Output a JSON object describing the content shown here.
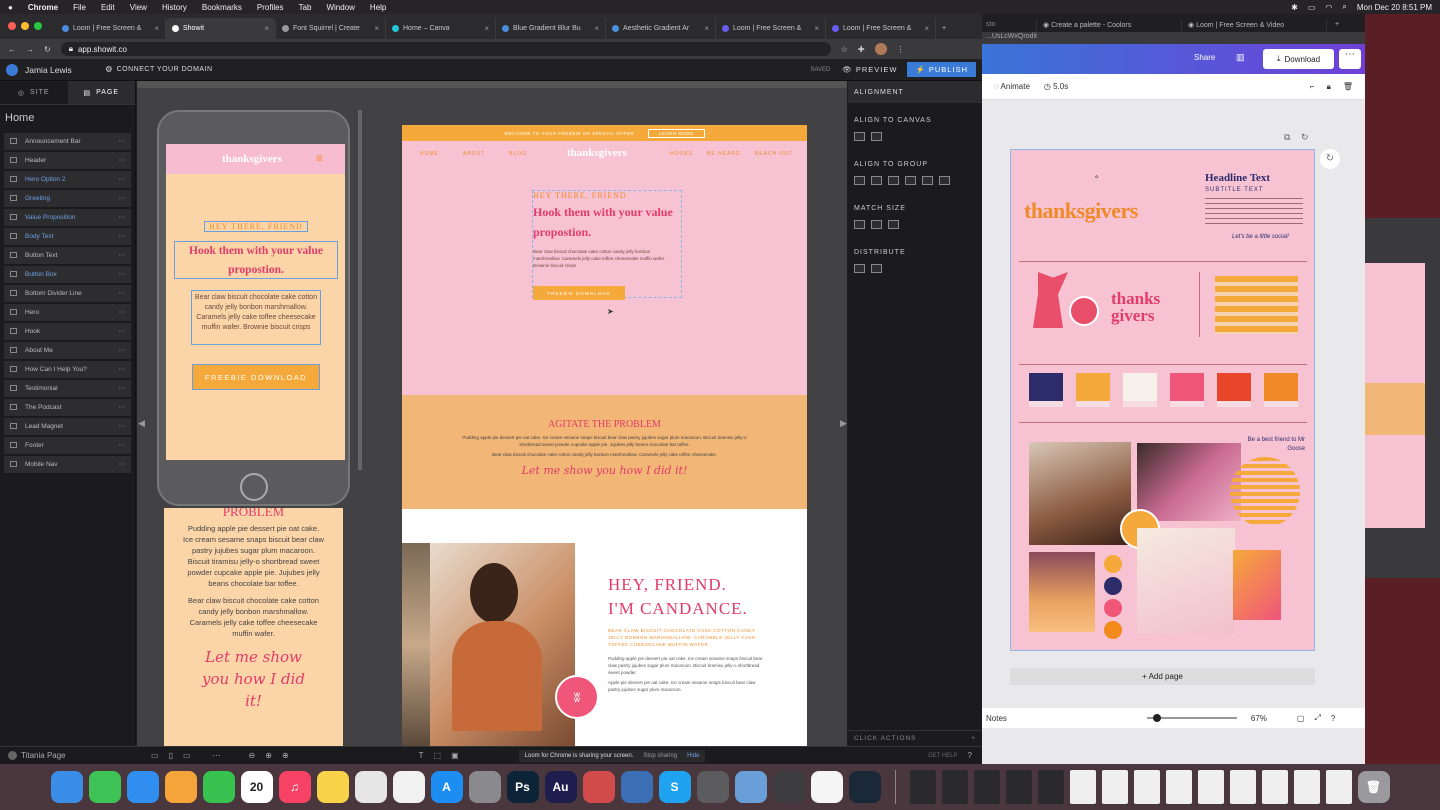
{
  "menubar": {
    "apple": "",
    "app": "Chrome",
    "items": [
      "File",
      "Edit",
      "View",
      "History",
      "Bookmarks",
      "Profiles",
      "Tab",
      "Window",
      "Help"
    ],
    "clock": "Mon Dec 20 8:51 PM"
  },
  "browser": {
    "tabs": [
      {
        "title": "Loom | Free Screen &"
      },
      {
        "title": "Showit",
        "active": true
      },
      {
        "title": "Font Squirrel | Create"
      },
      {
        "title": "Home – Canva"
      },
      {
        "title": "Blue Gradient Blur Bu"
      },
      {
        "title": "Aesthetic Gradient Ar"
      },
      {
        "title": "Loom | Free Screen &"
      },
      {
        "title": "Loom | Free Screen &"
      }
    ],
    "url": "app.showit.co"
  },
  "showit": {
    "user": "Jamia Lewis",
    "connect_domain": "CONNECT YOUR DOMAIN",
    "saved": "SAVED",
    "preview": "PREVIEW",
    "publish": "PUBLISH",
    "sidebar_tabs": [
      "SITE",
      "PAGE"
    ],
    "page_title": "Home",
    "layers": [
      {
        "label": "Announcement Bar",
        "sel": false
      },
      {
        "label": "Header",
        "sel": false
      },
      {
        "label": "Hero Option 2",
        "sel": true
      },
      {
        "label": "Greeting",
        "sel": true
      },
      {
        "label": "Value Proposition",
        "sel": true
      },
      {
        "label": "Body Text",
        "sel": true
      },
      {
        "label": "Button Text",
        "sel": false
      },
      {
        "label": "Button Box",
        "sel": true
      },
      {
        "label": "Bottom Divider Line",
        "sel": false
      },
      {
        "label": "Hero",
        "sel": false
      },
      {
        "label": "Hook",
        "sel": false
      },
      {
        "label": "About Me",
        "sel": false
      },
      {
        "label": "How Can I Help You?",
        "sel": false
      },
      {
        "label": "Testimonial",
        "sel": false
      },
      {
        "label": "The Podcast",
        "sel": false
      },
      {
        "label": "Lead Magnet",
        "sel": false
      },
      {
        "label": "Footer",
        "sel": false
      },
      {
        "label": "Mobile Nav",
        "sel": false
      }
    ],
    "right_panel": {
      "tab": "ALIGNMENT",
      "align_canvas": "ALIGN TO CANVAS",
      "align_group": "ALIGN TO GROUP",
      "match_size": "MATCH SIZE",
      "distribute": "DISTRIBUTE",
      "click_actions": "CLICK ACTIONS",
      "get_help": "GET HELP"
    },
    "status": {
      "page": "Titania Page",
      "loom_msg": "Loom for Chrome is sharing your screen.",
      "stop": "Stop sharing",
      "hide": "Hide"
    },
    "mobile": {
      "brand": "thanksgivers",
      "greeting": "HEY THERE, FRIEND",
      "hook": "Hook them with your value propostion.",
      "body": "Bear claw biscuit chocolate cake cotton candy jelly bonbon marshmallow. Caramels jelly cake toffee cheesecake muffin wafer. Brownie biscuit crisps",
      "button": "FREEBIE DOWNLOAD",
      "section2": "PROBLEM",
      "body2": "Pudding apple pie dessert pie oat cake. Ice cream sesame snaps biscuit bear claw pastry jujubes sugar plum macaroon. Biscuit tiramisu jelly-o shortbread sweet powder cupcake apple pie. Jujubes jelly beans chocolate bar toffee.",
      "body3": "Bear claw biscuit chocolate cake cotton candy jelly bonbon marshmallow. Caramels jelly cake toffee cheesecake muffin wafer.",
      "script": "Let me show you how I did it!"
    },
    "desktop": {
      "announce": "WELCOME TO YOUR FREEBIE OR SPECIAL OFFER",
      "announce_btn": "LEARN MORE",
      "nav_left": [
        "HOME",
        "ABOUT",
        "BLOG"
      ],
      "brand": "thanksgivers",
      "nav_right": [
        "HOOKS",
        "BE HEARD",
        "REACH OUT"
      ],
      "greeting": "HEY THERE, FRIEND",
      "hook": "Hook them with your value propostion.",
      "body": "Bear claw biscuit chocolate cake cotton candy jelly bonbon marshmallow. Caramels jelly cake toffee cheesecake muffin wafer. Brownie biscuit crisps",
      "button": "FREEBIE DOWNLOAD",
      "problem": "AGITATE THE PROBLEM",
      "problem_body": "Pudding apple pie dessert pie oat cake. Ice cream sesame snaps biscuit bear claw pastry jujubes sugar plum macaroon. Biscuit tiramisu jelly-o shortbread sweet powder cupcake apple pie. Jujubes jelly beans chocolate bar toffee.",
      "problem_body2": "Bear claw biscuit chocolate cake cotton candy jelly bonbon marshmallow. Caramels jelly cake toffee cheesecake.",
      "script": "Let me show you how I did it!",
      "hey": "HEY, FRIEND.",
      "im": "I'M CANDANCE.",
      "about_sub": "BEAR CLAW BISCUIT CHOCOLATE CAKE COTTON CANDY JELLY BONBON MARSHMALLOW. CARAMELS JELLY CAKE TOFFEE CHEESECAKE MUFFIN WAFER.",
      "about_body": "Pudding apple pie dessert pie oat cake. Ice cream sesame snaps biscuit bear claw pastry jujubes sugar plum macaroon. Biscuit tiramisu jelly-o shortbread sweet powder.",
      "about_body2": "Apple pie dessert pie oat cake. Ice cream sesame snaps biscuit bear claw pastry jujubes sugar plum macaroon."
    }
  },
  "canva": {
    "tabs": [
      {
        "title": "Create a palette - Coolors"
      },
      {
        "title": "Loom | Free Screen & Video"
      }
    ],
    "url": "...UsLcWxQrodit",
    "share": "Share",
    "download": "Download",
    "animate": "Animate",
    "duration": "5.0s",
    "board": {
      "headline": "Headline Text",
      "subline": "SUBTITLE TEXT",
      "brand": "thanksgivers",
      "brand2a": "thanks",
      "brand2b": "givers",
      "script": "Let's be a little social!",
      "tagline": "Be a best friend to Mr Goose",
      "swatch_colors": [
        "#2d2c6b",
        "#f6a93b",
        "#f5f0ea",
        "#f0557a",
        "#e8462a",
        "#f08a28"
      ],
      "dot_colors": [
        "#f6a93b",
        "#2d2c6b",
        "#f0557a",
        "#f28a1c"
      ]
    },
    "add_page": "+ Add page",
    "notes": "Notes",
    "zoom": "67%"
  },
  "dock": {
    "apps": [
      {
        "name": "finder",
        "color": "#3b8ee8",
        "label": ""
      },
      {
        "name": "messages",
        "color": "#3fc256",
        "label": ""
      },
      {
        "name": "safari",
        "color": "#2f8ef0",
        "label": ""
      },
      {
        "name": "photos",
        "color": "#f5a43a",
        "label": ""
      },
      {
        "name": "facetime",
        "color": "#38c24f",
        "label": ""
      },
      {
        "name": "calendar",
        "color": "#ffffff",
        "label": "20"
      },
      {
        "name": "music",
        "color": "#f64365",
        "label": "♫"
      },
      {
        "name": "notes",
        "color": "#f8d34a",
        "label": ""
      },
      {
        "name": "chrome",
        "color": "#e6e6e6",
        "label": ""
      },
      {
        "name": "pencil",
        "color": "#f2f2f2",
        "label": ""
      },
      {
        "name": "appstore",
        "color": "#1c8ef2",
        "label": "A"
      },
      {
        "name": "settings",
        "color": "#8a8a8e",
        "label": ""
      },
      {
        "name": "photoshop",
        "color": "#0d2338",
        "label": "Ps"
      },
      {
        "name": "audition",
        "color": "#1f1d4e",
        "label": "Au"
      },
      {
        "name": "vpn",
        "color": "#d14b4b",
        "label": ""
      },
      {
        "name": "quicktime",
        "color": "#3a6fb5",
        "label": ""
      },
      {
        "name": "skype",
        "color": "#1fa3f0",
        "label": "S"
      },
      {
        "name": "calculator",
        "color": "#5c5c5e",
        "label": ""
      },
      {
        "name": "preview",
        "color": "#6a9ed8",
        "label": ""
      },
      {
        "name": "screenshot",
        "color": "#3d3d40",
        "label": ""
      },
      {
        "name": "reminders",
        "color": "#f5f5f5",
        "label": ""
      },
      {
        "name": "steam",
        "color": "#1b2838",
        "label": ""
      }
    ]
  }
}
